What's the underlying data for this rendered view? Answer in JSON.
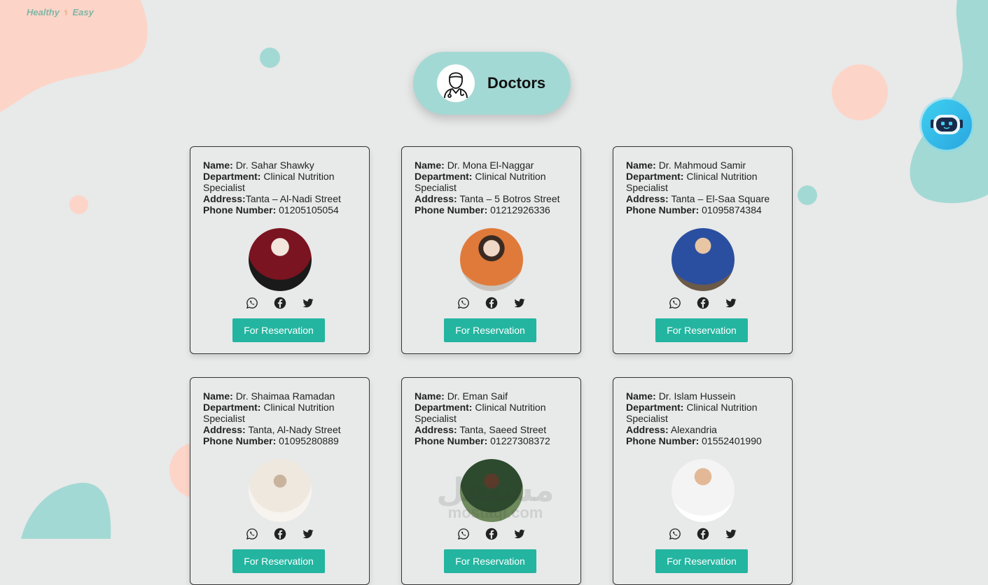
{
  "brand": {
    "tagline_left": "Healthy",
    "tagline_right": "Easy"
  },
  "header": {
    "title": "Doctors",
    "icon": "doctor-icon"
  },
  "chatbot": {
    "icon": "robot-icon"
  },
  "labels": {
    "name": "Name:",
    "department": "Department:",
    "address": "Address:",
    "phone": "Phone Number:",
    "reserve_button": "For Reservation"
  },
  "doctors": [
    {
      "name": "Dr. Sahar Shawky",
      "department": "Clinical Nutrition Specialist",
      "address": "Tanta – Al-Nadi Street",
      "phone": "01205105054"
    },
    {
      "name": "Dr. Mona El-Naggar",
      "department": "Clinical Nutrition Specialist",
      "address": "Tanta – 5 Botros Street",
      "phone": "01212926336"
    },
    {
      "name": "Dr. Mahmoud Samir",
      "department": "Clinical Nutrition Specialist",
      "address": "Tanta – El-Saa Square",
      "phone": "01095874384"
    },
    {
      "name": "Dr. Shaimaa Ramadan",
      "department": "Clinical Nutrition Specialist",
      "address": "Tanta, Al-Nady Street",
      "phone": "01095280889"
    },
    {
      "name": "Dr. Eman Saif",
      "department": "Clinical Nutrition Specialist",
      "address": "Tanta, Saeed Street",
      "phone": "01227308372"
    },
    {
      "name": "Dr. Islam Hussein",
      "department": "Clinical Nutrition Specialist",
      "address": "Alexandria",
      "phone": "01552401990"
    }
  ],
  "socials": [
    "whatsapp-icon",
    "facebook-icon",
    "twitter-icon"
  ],
  "watermark": {
    "arabic": "مستقل",
    "latin": "mostaql.com"
  },
  "colors": {
    "accent": "#23b5a0",
    "teal": "#a3d9d4",
    "peach": "#fcd5c8",
    "background": "#e8e9e9"
  }
}
